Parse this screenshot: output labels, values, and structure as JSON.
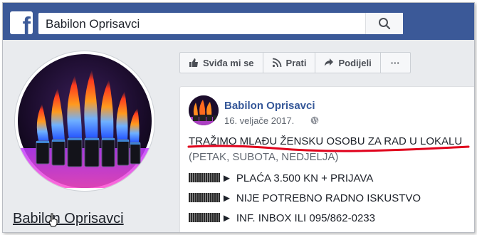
{
  "header": {
    "logo_letter": "f",
    "search_value": "Babilon Oprisavci"
  },
  "left": {
    "page_name": "Babilon Oprisavci"
  },
  "actions": [
    {
      "label": "Sviđa mi se",
      "icon": "thumbs-up-icon"
    },
    {
      "label": "Prati",
      "icon": "rss-icon"
    },
    {
      "label": "Podijeli",
      "icon": "share-arrow-icon"
    },
    {
      "label": "···",
      "icon": "more-icon"
    }
  ],
  "post": {
    "author": "Babilon Oprisavci",
    "date": "16. veljače 2017.",
    "headline": "TRAŽIMO MLAĐU ŽENSKU OSOBU ZA RAD U LOKALU",
    "days": "(PETAK, SUBOTA, NEDJELJA)",
    "items": [
      {
        "arrow": "►",
        "text": "PLAĆA 3.500 KN + PRIJAVA"
      },
      {
        "arrow": "►",
        "text": "NIJE POTREBNO RADNO ISKUSTVO"
      },
      {
        "arrow": "►",
        "text": "INF. INBOX ILI 095/862-0233"
      }
    ]
  },
  "colors": {
    "facebook_blue": "#3b5998",
    "link_blue": "#365899",
    "annotation_red": "#e0001b"
  }
}
